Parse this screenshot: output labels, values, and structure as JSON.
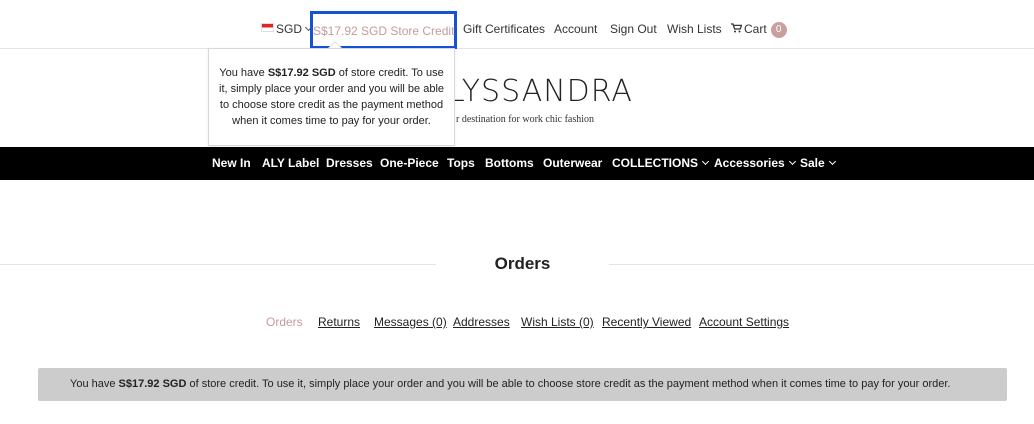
{
  "topbar": {
    "currency": "SGD",
    "store_credit_link": "S$17.92 SGD Store Credit",
    "gift_certificates": "Gift Certificates",
    "account": "Account",
    "sign_out": "Sign Out",
    "wish_lists": "Wish Lists",
    "cart": "Cart",
    "cart_count": "0"
  },
  "popover": {
    "prefix": "You have ",
    "amount": "S$17.92 SGD",
    "suffix": " of store credit. To use it, simply place your order and you will be able to choose store credit as the payment method when it comes time to pay for your order."
  },
  "logo": {
    "name": "LYSSANDRA",
    "tagline": "r destination for work chic fashion"
  },
  "nav": {
    "items": [
      {
        "label": "New In",
        "dropdown": false
      },
      {
        "label": "ALY Label",
        "dropdown": false
      },
      {
        "label": "Dresses",
        "dropdown": false
      },
      {
        "label": "One-Piece",
        "dropdown": false
      },
      {
        "label": "Tops",
        "dropdown": false
      },
      {
        "label": "Bottoms",
        "dropdown": false
      },
      {
        "label": "Outerwear",
        "dropdown": false
      },
      {
        "label": "COLLECTIONS",
        "dropdown": true
      },
      {
        "label": "Accessories",
        "dropdown": true
      },
      {
        "label": "Sale",
        "dropdown": true
      }
    ]
  },
  "page": {
    "title": "Orders"
  },
  "tabs": [
    {
      "label": "Orders",
      "active": true
    },
    {
      "label": "Returns",
      "active": false
    },
    {
      "label": "Messages (0)",
      "active": false
    },
    {
      "label": "Addresses",
      "active": false
    },
    {
      "label": "Wish Lists (0)",
      "active": false
    },
    {
      "label": "Recently Viewed",
      "active": false
    },
    {
      "label": "Account Settings",
      "active": false
    }
  ],
  "alert": {
    "prefix": "You have ",
    "amount": "S$17.92 SGD",
    "suffix": " of store credit. To use it, simply place your order and you will be able to choose store credit as the payment method when it comes time to pay for your order."
  },
  "colors": {
    "accent": "#c69b9b",
    "highlight_border": "#1652d6",
    "nav_background": "#000000",
    "alert_background": "#cccccc"
  }
}
